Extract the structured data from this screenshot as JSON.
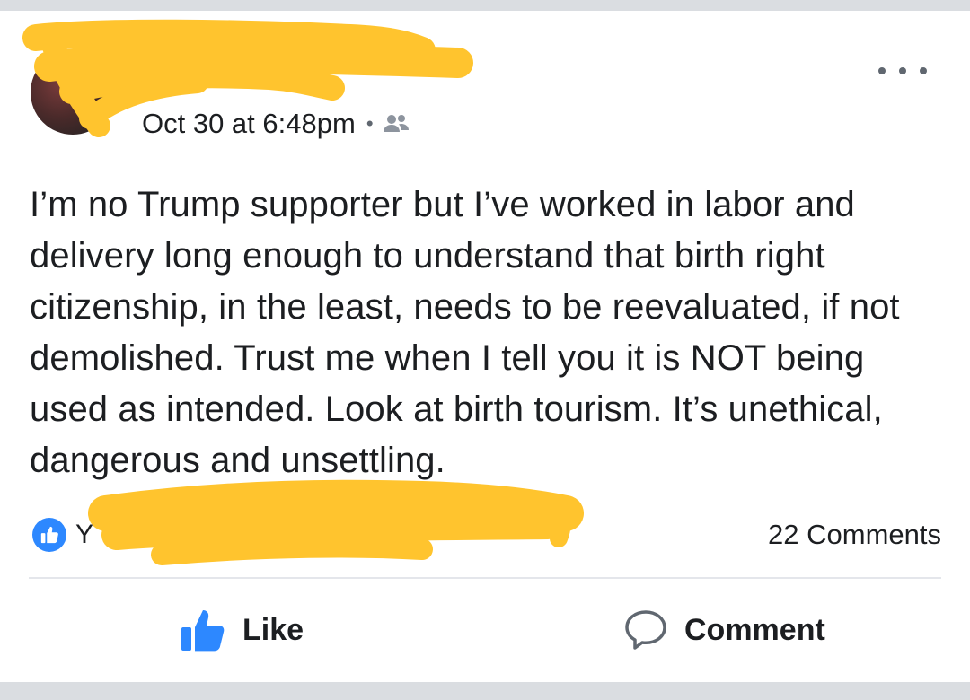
{
  "post": {
    "author_name": "",
    "timestamp": "Oct 30 at 6:48pm",
    "separator": "•",
    "audience_icon": "friends-icon",
    "more_icon": "more-horizontal-icon",
    "body": "I’m no Trump supporter but I’ve worked in labor and delivery long enough to understand that birth right citizenship, in the least, needs to be reevaluated, if not demolished. Trust me when I tell you it is NOT being used as intended. Look at birth tourism. It’s unethical, dangerous and unsettling."
  },
  "reactions": {
    "icon": "like-reaction-icon",
    "names": "Y"
  },
  "comments_count": "22 Comments",
  "actions": {
    "like_label": "Like",
    "like_icon": "thumbs-up-icon",
    "comment_label": "Comment",
    "comment_icon": "comment-bubble-icon"
  },
  "colors": {
    "brand_blue": "#2d88ff",
    "text": "#1c1e21",
    "secondary": "#606770",
    "redaction": "#ffc42e"
  }
}
